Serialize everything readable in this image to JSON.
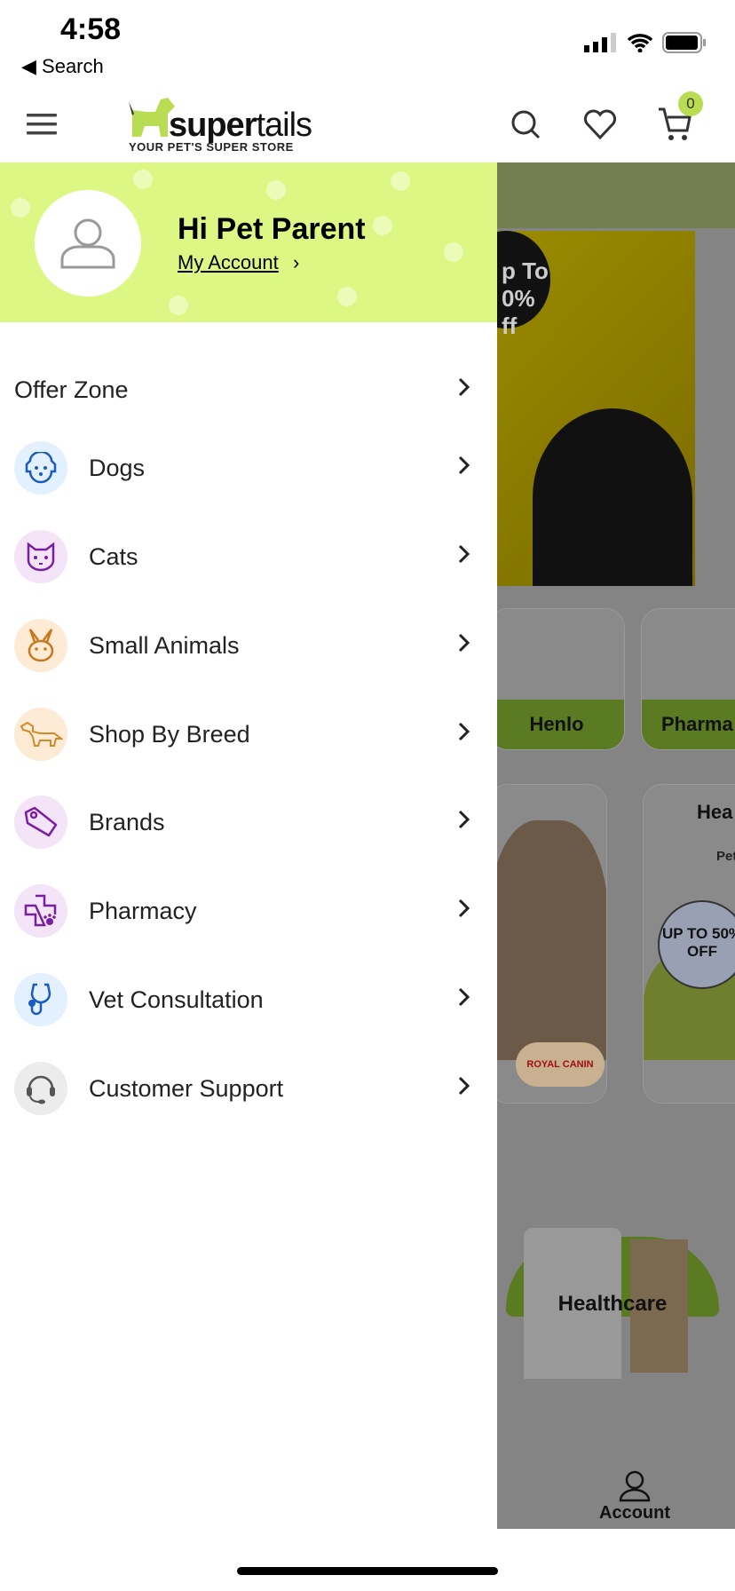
{
  "status_bar": {
    "time": "4:58",
    "back_label": "Search"
  },
  "header": {
    "logo_brand_a": "super",
    "logo_brand_b": "tails",
    "logo_tagline": "YOUR PET'S SUPER STORE",
    "cart_count": "0",
    "icons": [
      "menu-icon",
      "search-icon",
      "heart-icon",
      "cart-icon"
    ]
  },
  "drawer": {
    "greeting": "Hi Pet Parent",
    "account_link": "My Account",
    "header_color": "#dcf784",
    "items": [
      {
        "label": "Offer Zone",
        "icon": null
      },
      {
        "label": "Dogs",
        "icon": "dog-icon",
        "bg": "#e3f0ff",
        "color": "#1a5bbf"
      },
      {
        "label": "Cats",
        "icon": "cat-icon",
        "bg": "#f3e4f8",
        "color": "#7a1fa2"
      },
      {
        "label": "Small Animals",
        "icon": "rabbit-icon",
        "bg": "#fdebd6",
        "color": "#c8771b"
      },
      {
        "label": "Shop By Breed",
        "icon": "dog-breed-icon",
        "bg": "#fdebd6",
        "color": "#d08a2a"
      },
      {
        "label": "Brands",
        "icon": "tag-icon",
        "bg": "#f3e4f8",
        "color": "#7a1fa2"
      },
      {
        "label": "Pharmacy",
        "icon": "medical-cross-icon",
        "bg": "#f3e4f8",
        "color": "#7a1fa2"
      },
      {
        "label": "Vet Consultation",
        "icon": "stethoscope-icon",
        "bg": "#e3f0ff",
        "color": "#1a5bbf"
      },
      {
        "label": "Customer Support",
        "icon": "headset-icon",
        "bg": "#ececec",
        "color": "#555"
      }
    ]
  },
  "background": {
    "card_1": "Henlo",
    "card_2": "Pharma",
    "promo_title": "Hea",
    "promo_sub": "Pet",
    "promo_badge": "UP TO 50% OFF",
    "banner_text": "p To 0% ff",
    "brand_badge": "ROYAL CANIN",
    "healthcare": "Healthcare",
    "tab_account": "Account"
  }
}
